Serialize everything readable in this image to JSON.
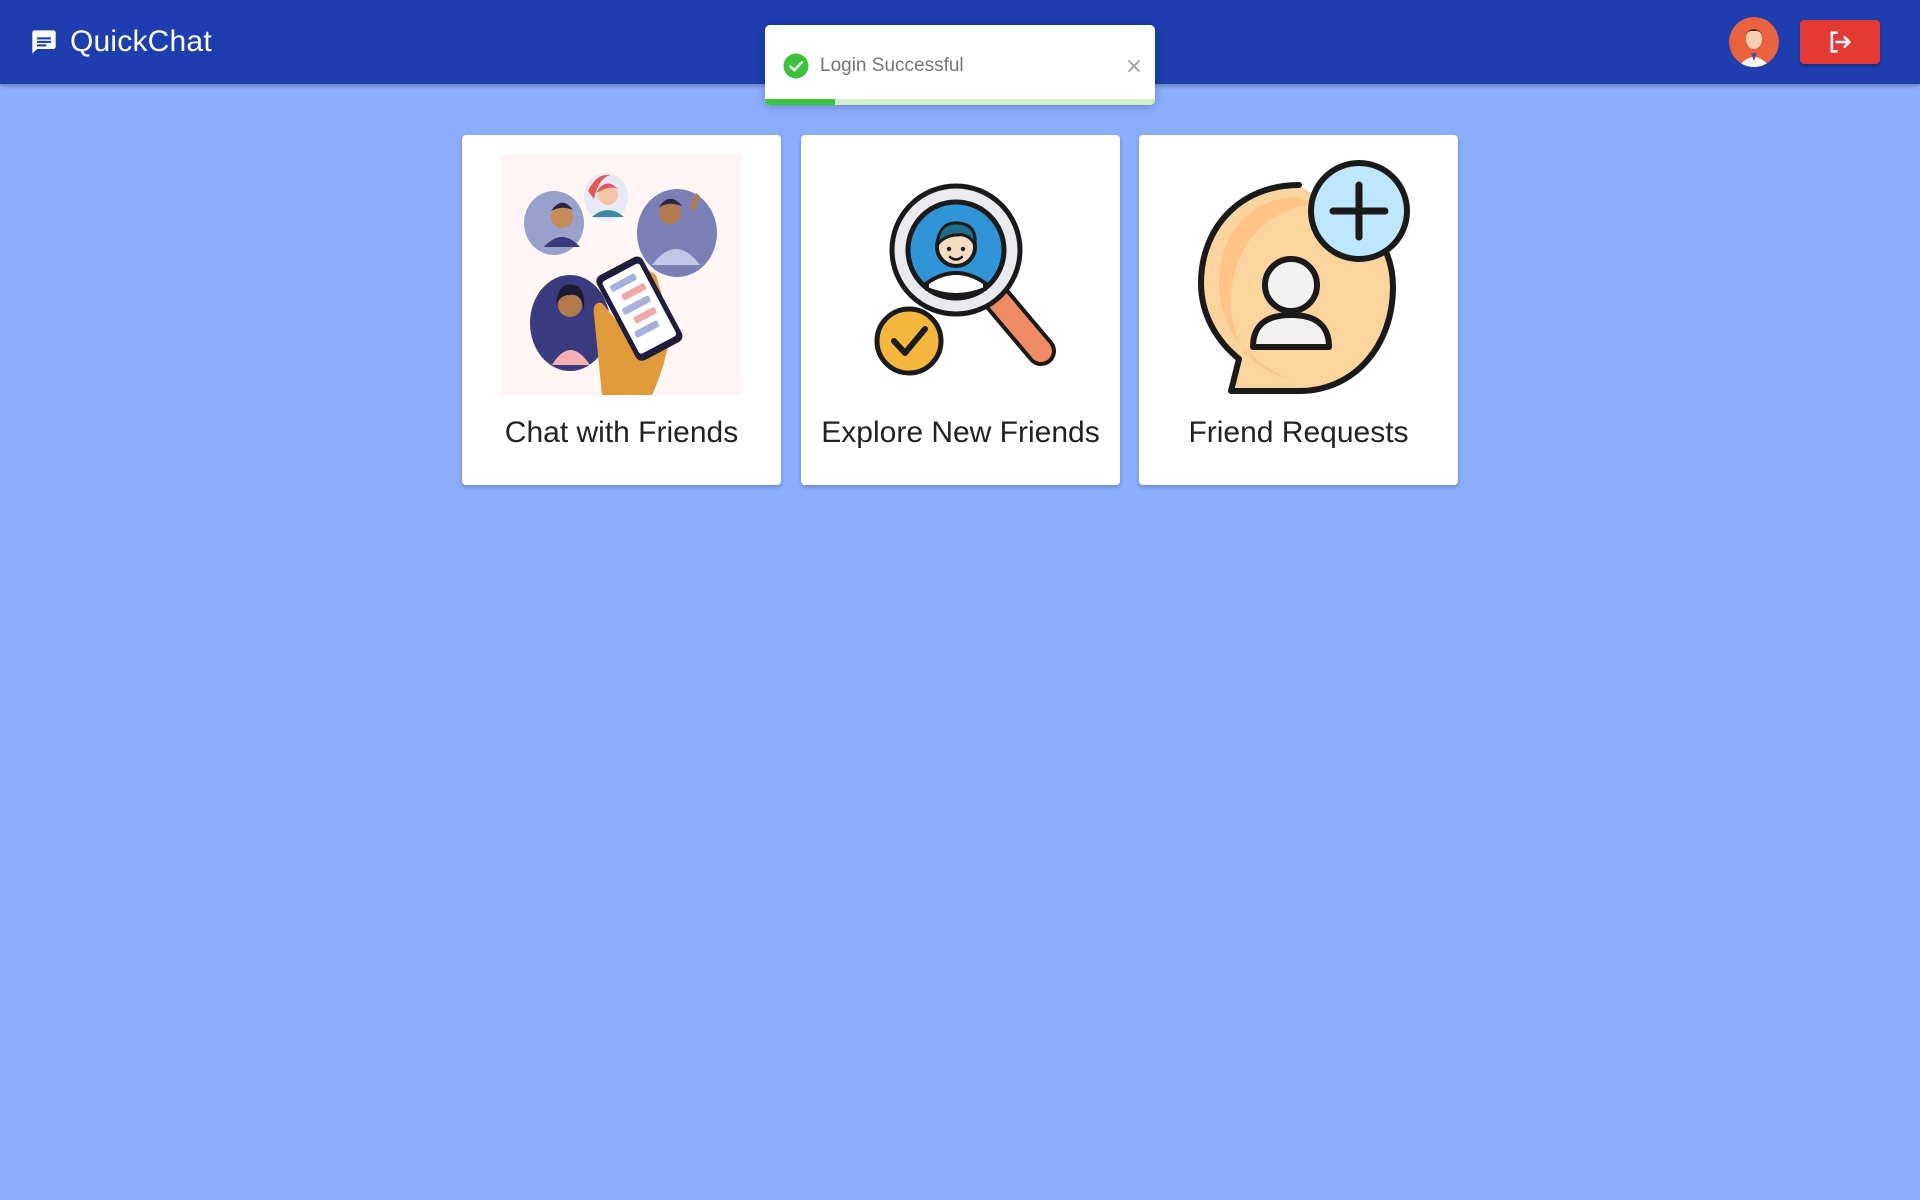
{
  "app": {
    "title": "QuickChat"
  },
  "header": {
    "brand_icon": "chat-bubble-icon",
    "avatar_icon": "user-avatar",
    "logout_icon": "logout-icon",
    "colors": {
      "bar": "#1e3eb0",
      "logout": "#e53935"
    }
  },
  "toast": {
    "message": "Login Successful",
    "icon": "check-circle-icon",
    "close_icon": "close-icon",
    "progress": 0.18,
    "colors": {
      "success": "#3cc23c"
    }
  },
  "cards": [
    {
      "label": "Chat with Friends",
      "icon": "people-chatting-illustration"
    },
    {
      "label": "Explore New Friends",
      "icon": "search-person-icon"
    },
    {
      "label": "Friend Requests",
      "icon": "add-friend-icon"
    }
  ],
  "colors": {
    "background": "#8aaefc"
  }
}
